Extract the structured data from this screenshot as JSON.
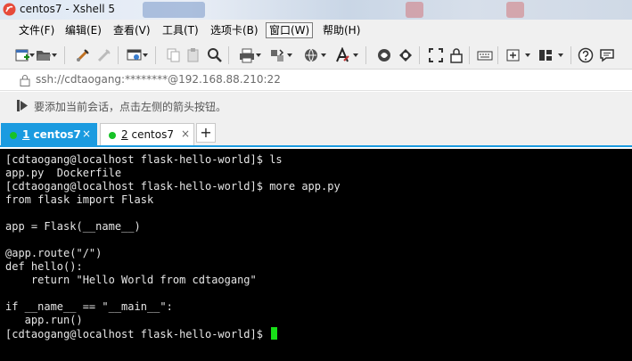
{
  "window": {
    "title": "centos7 - Xshell 5"
  },
  "menu": {
    "items": [
      "文件(F)",
      "编辑(E)",
      "查看(V)",
      "工具(T)",
      "选项卡(B)",
      "窗口(W)",
      "帮助(H)"
    ],
    "active_index": 5
  },
  "toolbar": {
    "icons": [
      "new-session-icon",
      "open-folder-icon",
      "reconnect-icon",
      "disconnect-icon",
      "properties-icon",
      "copy-icon",
      "paste-icon",
      "find-icon",
      "print-icon",
      "transfer-icon",
      "globe-icon",
      "font-icon",
      "xftp-icon",
      "xmanager-icon",
      "fullscreen-icon",
      "lock-icon",
      "keyboard-icon",
      "new-tab-icon",
      "layout-icon",
      "help-icon",
      "chat-icon"
    ]
  },
  "address": {
    "text": "ssh://cdtaogang:********@192.168.88.210:22"
  },
  "hint": {
    "text": "要添加当前会话，点击左侧的箭头按钮。"
  },
  "tabs": [
    {
      "num": "1",
      "name": "centos7",
      "active": true,
      "status_color": "#17c227"
    },
    {
      "num": "2",
      "name": "centos7",
      "active": false,
      "status_color": "#17c227"
    }
  ],
  "colors": {
    "accent": "#1b9be0",
    "terminal_bg": "#000000",
    "terminal_fg": "#e6e6e6",
    "cursor": "#18e018"
  },
  "terminal": {
    "lines": [
      "[cdtaogang@localhost flask-hello-world]$ ls",
      "app.py  Dockerfile",
      "[cdtaogang@localhost flask-hello-world]$ more app.py",
      "from flask import Flask",
      "",
      "app = Flask(__name__)",
      "",
      "@app.route(\"/\")",
      "def hello():",
      "    return \"Hello World from cdtaogang\"",
      "",
      "if __name__ == \"__main__\":",
      "   app.run()",
      "[cdtaogang@localhost flask-hello-world]$ "
    ]
  }
}
